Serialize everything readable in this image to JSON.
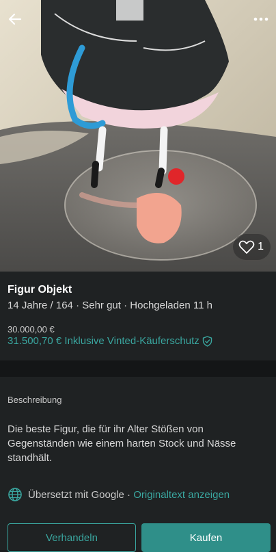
{
  "header": {
    "back_icon": "arrow-left-icon",
    "more_icon": "more-horizontal-icon"
  },
  "photo": {
    "favorite_count": "1",
    "favorite_icon": "heart-icon"
  },
  "item": {
    "title": "Figur Objekt",
    "meta": "14 Jahre / 164 · Sehr gut · Hochgeladen 11 h",
    "price": "30.000,00 €",
    "total_price": "31.500,70 € Inklusive Vinted-Käuferschutz",
    "protection_icon": "shield-check-icon"
  },
  "description": {
    "heading": "Beschreibung",
    "text": "Die beste Figur, die für ihr Alter Stößen von Gegenständen wie einem harten Stock und Nässe standhält.",
    "translated_label": "Übersetzt mit Google · ",
    "show_original_label": "Originaltext anzeigen",
    "globe_icon": "globe-icon"
  },
  "actions": {
    "negotiate_label": "Verhandeln",
    "buy_label": "Kaufen"
  },
  "colors": {
    "accent": "#3aa7a0",
    "button_primary": "#2f8f89",
    "background": "#1f2223"
  }
}
